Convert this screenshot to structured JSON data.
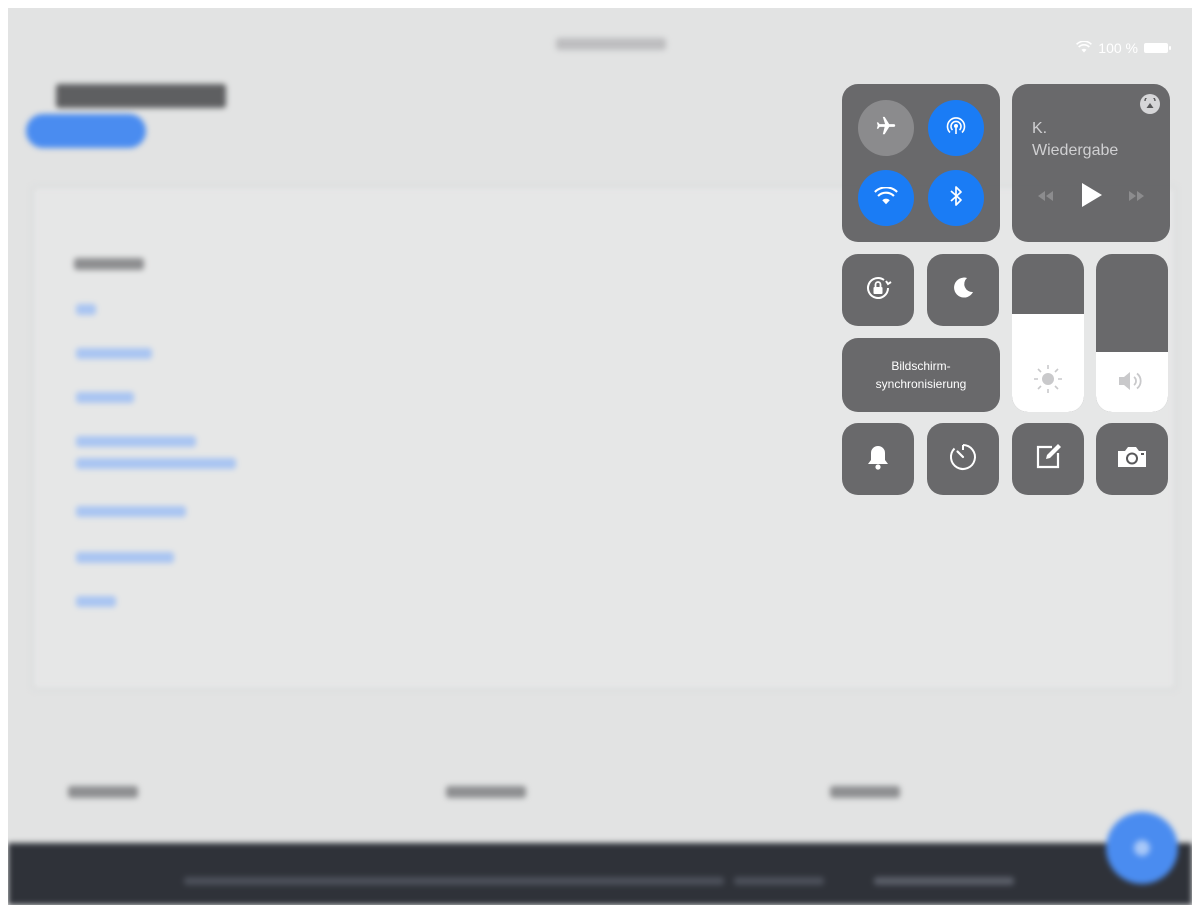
{
  "status_bar": {
    "battery_text": "100 %",
    "wifi_icon": "wifi-icon",
    "battery_icon": "battery-icon"
  },
  "control_center": {
    "connectivity": {
      "airplane_mode": {
        "icon": "airplane-icon",
        "active": false
      },
      "airdrop": {
        "icon": "airdrop-icon",
        "active": true
      },
      "wifi": {
        "icon": "wifi-icon",
        "active": true
      },
      "bluetooth": {
        "icon": "bluetooth-icon",
        "active": true
      }
    },
    "media": {
      "title": "K.\nWiedergabe",
      "airplay_icon": "airplay-icon",
      "rewind_icon": "rewind-icon",
      "play_icon": "play-icon",
      "forward_icon": "fast-forward-icon"
    },
    "orientation_lock": {
      "icon": "orientation-lock-icon"
    },
    "do_not_disturb": {
      "icon": "moon-icon"
    },
    "screen_mirroring": {
      "label": "Bildschirm-\nsynchronisierung"
    },
    "brightness": {
      "icon": "sun-icon",
      "level": 0.62
    },
    "volume": {
      "icon": "speaker-icon",
      "level": 0.38
    },
    "bottom_row": [
      {
        "icon": "bell-icon"
      },
      {
        "icon": "timer-icon"
      },
      {
        "icon": "notes-icon"
      },
      {
        "icon": "camera-icon"
      }
    ]
  },
  "colors": {
    "accent": "#1a7cf5",
    "tile": "#58585a",
    "backdrop": "#e2e3e3",
    "footer": "#2f3239"
  }
}
